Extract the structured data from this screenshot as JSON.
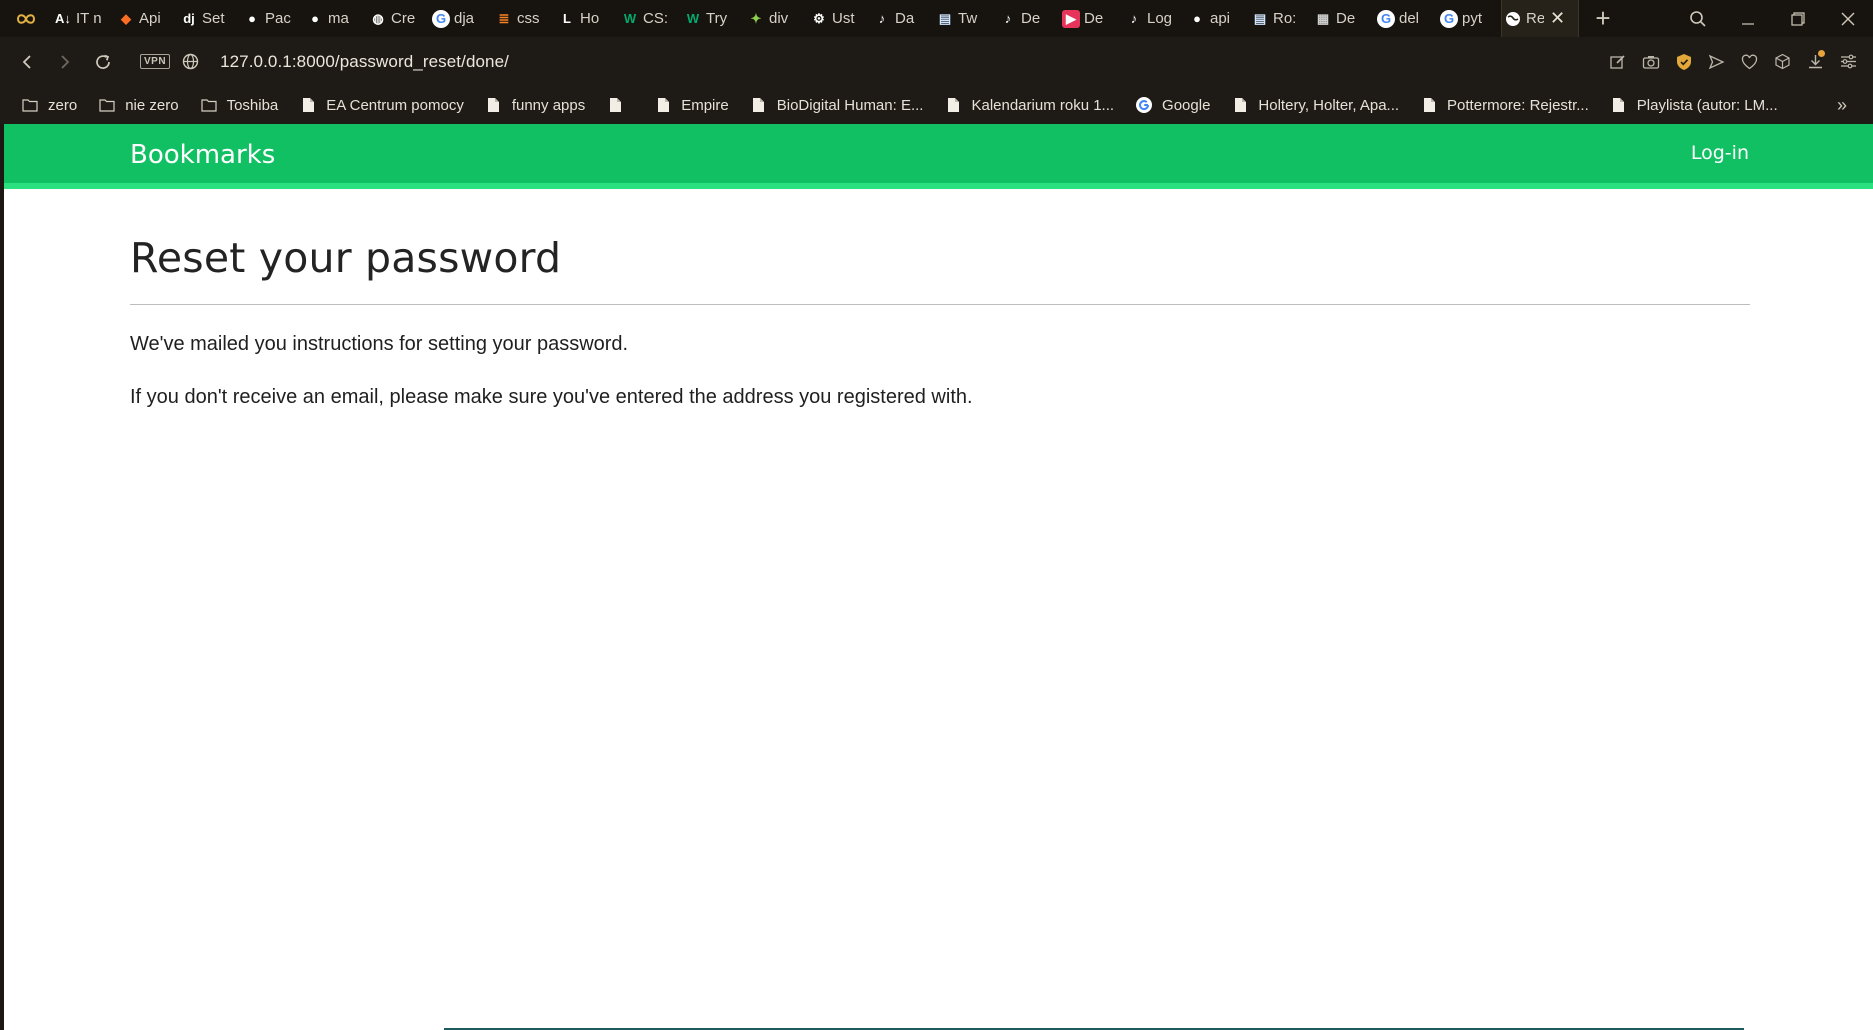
{
  "browser": {
    "tabs": [
      {
        "label": "IT n",
        "icon": "az-sort-icon",
        "glyph": "A↓",
        "color": "#ffffff",
        "bg": "transparent"
      },
      {
        "label": "Api",
        "icon": "gitlab-icon",
        "glyph": "◆",
        "color": "#fc6d26",
        "bg": "transparent"
      },
      {
        "label": "Set",
        "icon": "django-icon",
        "glyph": "dj",
        "color": "#ffffff",
        "bg": "transparent"
      },
      {
        "label": "Pac",
        "icon": "github-icon",
        "glyph": "●",
        "color": "#ffffff",
        "bg": "transparent"
      },
      {
        "label": "ma",
        "icon": "github-icon",
        "glyph": "●",
        "color": "#ffffff",
        "bg": "transparent"
      },
      {
        "label": "Cre",
        "icon": "globe-icon",
        "glyph": "◍",
        "color": "#ffffff",
        "bg": "transparent"
      },
      {
        "label": "dja",
        "icon": "google-icon",
        "glyph": "G",
        "color": "#4285f4",
        "bg": "#ffffff"
      },
      {
        "label": "css",
        "icon": "stackoverflow-icon",
        "glyph": "≣",
        "color": "#f48024",
        "bg": "transparent"
      },
      {
        "label": "Ho",
        "icon": "l-letter-icon",
        "glyph": "L",
        "color": "#ffffff",
        "bg": "transparent"
      },
      {
        "label": "CS:",
        "icon": "w3schools-icon",
        "glyph": "W",
        "color": "#04aa6d",
        "bg": "transparent"
      },
      {
        "label": "Try",
        "icon": "w3schools-icon",
        "glyph": "W",
        "color": "#04aa6d",
        "bg": "transparent"
      },
      {
        "label": "div",
        "icon": "sparkle-icon",
        "glyph": "✦",
        "color": "#8fd14f",
        "bg": "transparent"
      },
      {
        "label": "Ust",
        "icon": "gear-icon",
        "glyph": "⚙",
        "color": "#ffffff",
        "bg": "transparent"
      },
      {
        "label": "Da",
        "icon": "music-note-icon",
        "glyph": "♪",
        "color": "#ffffff",
        "bg": "transparent"
      },
      {
        "label": "Tw",
        "icon": "book-icon",
        "glyph": "▤",
        "color": "#cfe4ff",
        "bg": "transparent"
      },
      {
        "label": "De",
        "icon": "music-note-icon",
        "glyph": "♪",
        "color": "#ffffff",
        "bg": "transparent"
      },
      {
        "label": "De",
        "icon": "play-icon",
        "glyph": "▶",
        "color": "#ffffff",
        "bg": "#e6345a"
      },
      {
        "label": "Log",
        "icon": "music-note-icon",
        "glyph": "♪",
        "color": "#ffffff",
        "bg": "transparent"
      },
      {
        "label": "api",
        "icon": "github-icon",
        "glyph": "●",
        "color": "#ffffff",
        "bg": "transparent"
      },
      {
        "label": "Ro:",
        "icon": "book-icon",
        "glyph": "▤",
        "color": "#cfe4ff",
        "bg": "transparent"
      },
      {
        "label": "De",
        "icon": "document-icon",
        "glyph": "▦",
        "color": "#cfcfcf",
        "bg": "transparent"
      },
      {
        "label": "del",
        "icon": "google-icon",
        "glyph": "G",
        "color": "#4285f4",
        "bg": "#ffffff"
      },
      {
        "label": "pyt",
        "icon": "google-icon",
        "glyph": "G",
        "color": "#4285f4",
        "bg": "#ffffff"
      }
    ],
    "active_tab": {
      "label": "Re",
      "icon": "globe-icon",
      "glyph": "◍"
    },
    "url": "127.0.0.1:8000/password_reset/done/",
    "vpn_label": "VPN",
    "bookmarks": [
      {
        "label": "zero",
        "icon": "folder-icon"
      },
      {
        "label": "nie zero",
        "icon": "folder-icon"
      },
      {
        "label": "Toshiba",
        "icon": "folder-icon"
      },
      {
        "label": "EA Centrum pomocy",
        "icon": "page-icon"
      },
      {
        "label": "funny apps",
        "icon": "page-icon"
      },
      {
        "label": "",
        "icon": "page-icon"
      },
      {
        "label": "Empire",
        "icon": "page-icon"
      },
      {
        "label": "BioDigital Human: E...",
        "icon": "page-icon"
      },
      {
        "label": "Kalendarium roku 1...",
        "icon": "page-icon"
      },
      {
        "label": "Google",
        "icon": "google-icon"
      },
      {
        "label": "Holtery, Holter, Apa...",
        "icon": "page-icon"
      },
      {
        "label": "Pottermore: Rejestr...",
        "icon": "page-icon"
      },
      {
        "label": "Playlista (autor: LM...",
        "icon": "page-icon"
      }
    ],
    "bookmarks_more": "»"
  },
  "site": {
    "brand": "Bookmarks",
    "login_label": "Log-in",
    "header_color": "#12c064"
  },
  "page": {
    "title": "Reset your password",
    "line1": "We've mailed you instructions for setting your password.",
    "line2": "If you don't receive an email, please make sure you've entered the address you registered with."
  }
}
